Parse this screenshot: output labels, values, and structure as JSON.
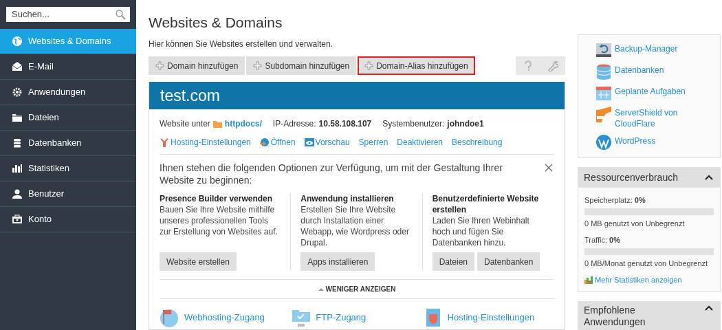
{
  "search": {
    "placeholder": "Suchen..."
  },
  "sidebar": {
    "items": [
      {
        "label": "Websites & Domains",
        "selected": true
      },
      {
        "label": "E-Mail",
        "selected": false
      },
      {
        "label": "Anwendungen",
        "selected": false
      },
      {
        "label": "Dateien",
        "selected": false
      },
      {
        "label": "Datenbanken",
        "selected": false
      },
      {
        "label": "Statistiken",
        "selected": false
      },
      {
        "label": "Benutzer",
        "selected": false
      },
      {
        "label": "Konto",
        "selected": false
      }
    ]
  },
  "page": {
    "title": "Websites & Domains",
    "subtitle": "Hier können Sie Websites erstellen und verwalten."
  },
  "toolbar": {
    "buttons": [
      {
        "label": "Domain hinzufügen",
        "highlighted": false
      },
      {
        "label": "Subdomain hinzufügen",
        "highlighted": false
      },
      {
        "label": "Domain-Alias hinzufügen",
        "highlighted": true
      }
    ]
  },
  "domain": {
    "name": "test.com",
    "location_label": "Website unter",
    "path": "httpdocs/",
    "ip_label": "IP-Adresse:",
    "ip": "10.58.108.107",
    "user_label": "Systembenutzer:",
    "user": "johndoe1",
    "actions": [
      "Hosting-Einstellungen",
      "Öffnen",
      "Vorschau",
      "Sperren",
      "Deaktivieren",
      "Beschreibung"
    ],
    "intro": "Ihnen stehen die folgenden Optionen zur Verfügung, um mit der Gestaltung Ihrer Website zu beginnen:",
    "options": [
      {
        "title": "Presence Builder verwenden",
        "text": "Bauen Sie Ihre Website mithilfe unseres professionellen Tools zur Erstellung von Websites auf.",
        "buttons": [
          "Website erstellen"
        ]
      },
      {
        "title": "Anwendung installieren",
        "text": "Erstellen Sie Ihre Website durch Installation einer Webapp, wie Wordpress oder Drupal.",
        "buttons": [
          "Apps installieren"
        ]
      },
      {
        "title": "Benutzerdefinierte Website erstellen",
        "text": "Laden Sie Ihren Webinhalt hoch und fügen Sie Datenbanken hinzu.",
        "buttons": [
          "Dateien",
          "Datenbanken"
        ]
      }
    ],
    "toggle": "WENIGER ANZEIGEN",
    "links": [
      "Webhosting-Zugang",
      "FTP-Zugang",
      "Hosting-Einstellungen"
    ]
  },
  "tools": [
    "Backup-Manager",
    "Datenbanken",
    "Geplante Aufgaben",
    "ServerShield von CloudFlare",
    "WordPress"
  ],
  "resources": {
    "title": "Ressourcenverbrauch",
    "expanded": true,
    "meters": [
      {
        "label": "Speicherplatz: **0%**",
        "level": 0,
        "note": "0 MB genutzt von Unbegrenzt"
      },
      {
        "label": "Traffic: **0%**",
        "level": 0,
        "note": "0 MB/Monat genutzt von Unbegrenzt"
      }
    ],
    "link": "Mehr Statistiken anzeigen"
  },
  "recommended": {
    "title": "Empfohlene Anwendungen",
    "expanded": true
  }
}
